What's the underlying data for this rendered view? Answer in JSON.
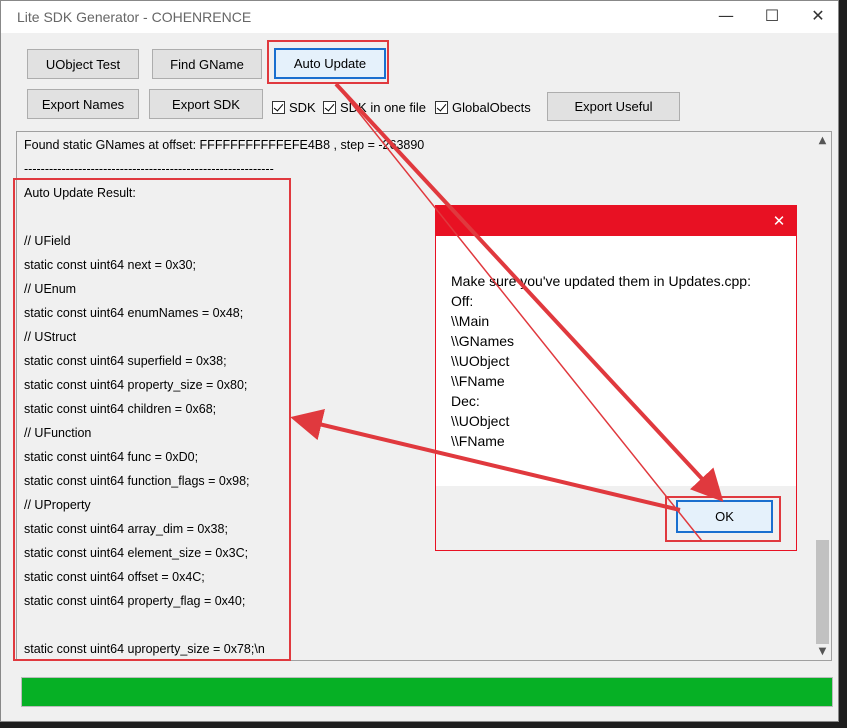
{
  "window": {
    "title": "Lite SDK Generator - COHENRENCE",
    "controls": {
      "minimize": "—",
      "maximize": "☐",
      "close": "✕"
    }
  },
  "toolbar": {
    "uobject_test": "UObject Test",
    "find_gname": "Find GName",
    "auto_update": "Auto Update",
    "export_names": "Export Names",
    "export_sdk": "Export SDK",
    "export_useful": "Export Useful"
  },
  "checkboxes": [
    {
      "label": "SDK",
      "checked": true
    },
    {
      "label": "SDK in one file",
      "checked": true
    },
    {
      "label": "GlobalObects",
      "checked": true
    }
  ],
  "log": {
    "lines": [
      "Found static GNames at offset: FFFFFFFFFFFEFE4B8 , step = -263890",
      "------------------------------------------------------------",
      "Auto Update Result:",
      "",
      "// UField",
      "static const uint64 next = 0x30;",
      "// UEnum",
      "static const uint64 enumNames = 0x48;",
      "// UStruct",
      "static const uint64 superfield = 0x38;",
      "static const uint64 property_size = 0x80;",
      "static const uint64 children = 0x68;",
      "// UFunction",
      "static const uint64 func = 0xD0;",
      "static const uint64 function_flags = 0x98;",
      "// UProperty",
      "static const uint64 array_dim = 0x38;",
      "static const uint64 element_size = 0x3C;",
      "static const uint64 offset = 0x4C;",
      "static const uint64 property_flag = 0x40;",
      "",
      "static const uint64 uproperty_size = 0x78;\\n"
    ]
  },
  "progress": {
    "value": 1.0,
    "color": "#06b025"
  },
  "dialog": {
    "close": "✕",
    "lines": [
      "Make sure you've updated them in Updates.cpp:",
      "Off:",
      "\\\\Main",
      "\\\\GNames",
      "\\\\UObject",
      "\\\\FName",
      "Dec:",
      "\\\\UObject",
      "\\\\FName"
    ],
    "ok_label": "OK",
    "accent": "#e81123"
  },
  "annotation_color": "#e0393e"
}
